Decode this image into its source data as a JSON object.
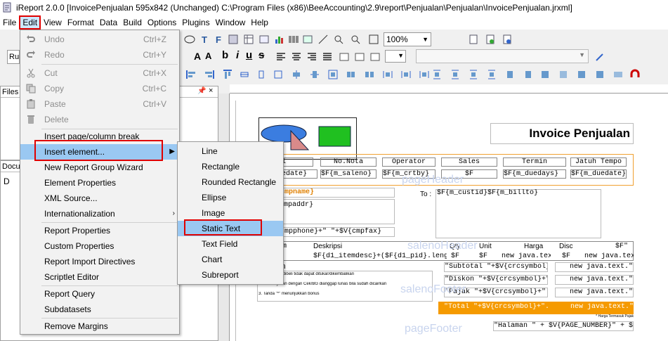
{
  "window": {
    "title": "iReport 2.0.0  [InvoicePenjualan 595x842 (Unchanged) C:\\Program Files (x86)\\BeeAccounting\\2.9\\report\\Penjualan\\Penjualan\\InvoicePenjualan.jrxml]"
  },
  "menubar": [
    "File",
    "Edit",
    "View",
    "Format",
    "Data",
    "Build",
    "Options",
    "Plugins",
    "Window",
    "Help"
  ],
  "toolbar": {
    "zoom": "100%"
  },
  "side_panels": {
    "files_title": "Files",
    "doc_title": "Docu",
    "doc_item": "D"
  },
  "edit_menu": {
    "items": [
      {
        "label": "Undo",
        "shortcut": "Ctrl+Z",
        "disabled": true
      },
      {
        "label": "Redo",
        "shortcut": "Ctrl+Y",
        "disabled": true
      },
      {
        "label": "Cut",
        "shortcut": "Ctrl+X",
        "disabled": true
      },
      {
        "label": "Copy",
        "shortcut": "Ctrl+C",
        "disabled": true
      },
      {
        "label": "Paste",
        "shortcut": "Ctrl+V",
        "disabled": true
      },
      {
        "label": "Delete",
        "shortcut": "",
        "disabled": true
      },
      {
        "label": "Insert page/column break",
        "shortcut": ""
      },
      {
        "label": "Insert element...",
        "shortcut": "",
        "submenu": true
      },
      {
        "label": "New Report Group Wizard",
        "shortcut": ""
      },
      {
        "label": "Element Properties",
        "shortcut": ""
      },
      {
        "label": "XML Source...",
        "shortcut": ""
      },
      {
        "label": "Internationalization",
        "shortcut": "",
        "submenu": true
      },
      {
        "label": "Report Properties",
        "shortcut": ""
      },
      {
        "label": "Custom Properties",
        "shortcut": ""
      },
      {
        "label": "Report Import Directives",
        "shortcut": ""
      },
      {
        "label": "Scriptlet Editor",
        "shortcut": ""
      },
      {
        "label": "Report Query",
        "shortcut": ""
      },
      {
        "label": "Subdatasets",
        "shortcut": ""
      },
      {
        "label": "Remove Margins",
        "shortcut": ""
      }
    ]
  },
  "insert_submenu": {
    "items": [
      "Line",
      "Rectangle",
      "Rounded Rectangle",
      "Ellipse",
      "Image",
      "Static Text",
      "Text Field",
      "Chart",
      "Subreport"
    ]
  },
  "report": {
    "title": "Invoice Penjualan",
    "header_cols": [
      "nggal",
      "No.Nota",
      "Operator",
      "Sales",
      "Termin",
      "Jatuh Tempo"
    ],
    "header_fields": [
      "_saledate}",
      "$F{m_saleno}",
      "$F{m_crtby}",
      "$F",
      "$F{m_duedays}",
      "$F{m_duedate}"
    ],
    "cmpname": "_cmpname}",
    "cmpaddr": "_cmpaddr}",
    "cmpphone": "_cmpphone}+\" \"+$V{cmpfax}",
    "to_label": "To :",
    "custid": "$F{m_custid}$F{m_billto}",
    "band_page_header": "pageHeader",
    "band_saleno_header": "salenoHeader",
    "band_saleno_footer": "salenoFooter",
    "band_page_footer": "pageFooter",
    "detail_cols": [
      "em",
      "Deskripsi",
      "Qty",
      "Unit",
      "Harga",
      "Disc",
      "$F\""
    ],
    "detail_fields": [
      "F",
      "$F{d1_itemdesc}+($F{d1_pid}.length()",
      "$F",
      "$F",
      "new java.text.",
      "$F",
      "new java.text."
    ],
    "keterangan": "ngan",
    "notes": [
      "...ang sudah dibeli tidak dapat ditukar/dikembalikan",
      "2. Pembayaran dengan Cek/BG dianggap lunas bila sudah dicairkan",
      "3. Tanda \"*\" menunjukkan bonus"
    ],
    "subtotal": "\"Subtotal \"+$V{crcsymbol}+\".\"\"",
    "diskon": "\"Diskon \"+$V{crcsymbol}+\"\"",
    "pajak": "\"Pajak \"+$V{crcsymbol}+\".\"\"",
    "total": "\"Total \"+$V{crcsymbol}+\".\"\"",
    "new_java": "new java.text.\"",
    "harga_note": "* Harga Termasuk Pajak",
    "halaman": "\"Halaman \" + $V{PAGE_NUMBER}\" + $V"
  }
}
